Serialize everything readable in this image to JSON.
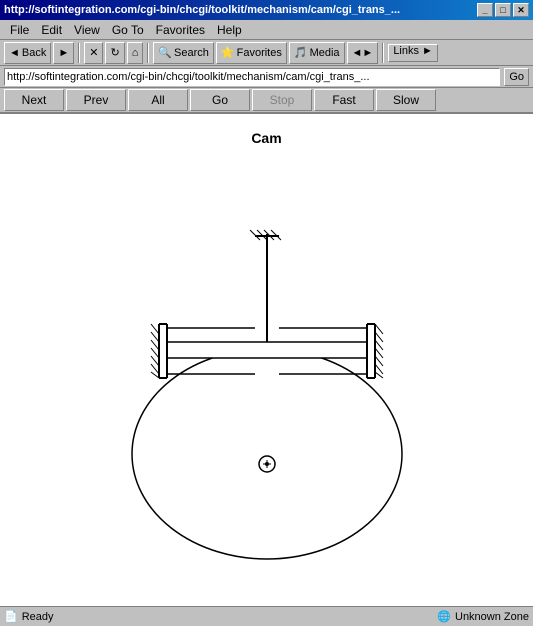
{
  "titlebar": {
    "text": "http://softintegration.com/cgi-bin/chcgi/toolkit/mechanism/cam/cgi_trans_...",
    "minimize": "_",
    "maximize": "□",
    "close": "✕"
  },
  "menubar": {
    "items": [
      "File",
      "Edit",
      "View",
      "Go To",
      "Favorites",
      "Help"
    ]
  },
  "toolbar": {
    "back": "◄ Back",
    "forward": "►",
    "stop": "✕",
    "refresh": "↻",
    "home": "⌂",
    "search": "Search",
    "favorites": "Favorites",
    "media": "Media",
    "history": "◄►",
    "links": "Links ►"
  },
  "nav": {
    "next": "Next",
    "prev": "Prev",
    "all": "All",
    "go": "Go",
    "stop": "Stop",
    "fast": "Fast",
    "slow": "Slow"
  },
  "diagram": {
    "title": "Cam"
  },
  "statusbar": {
    "left": "Ready",
    "zone": "Unknown Zone"
  }
}
